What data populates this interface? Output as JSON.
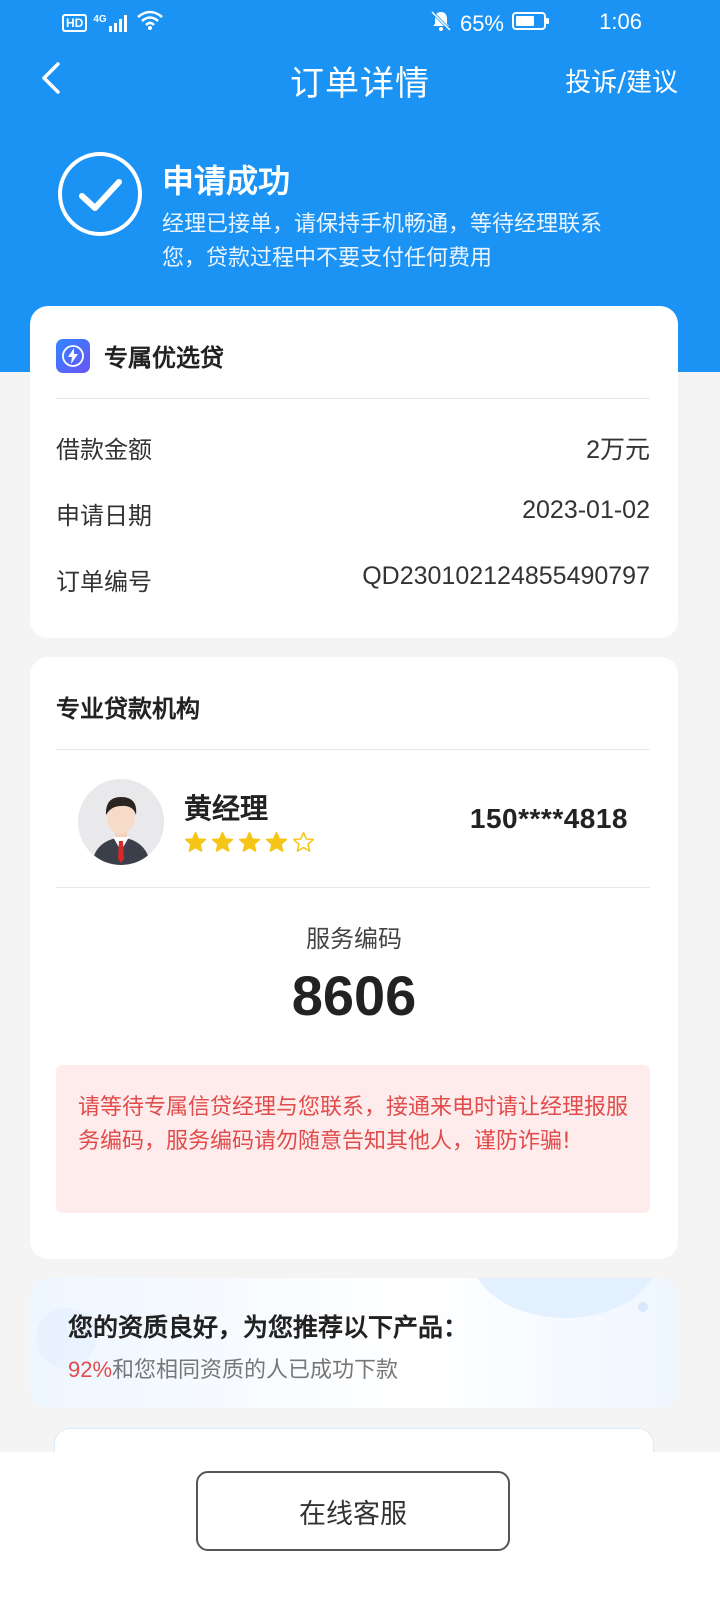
{
  "status_bar": {
    "network": "HD",
    "signal_type": "4G",
    "battery": "65%",
    "time": "1:06"
  },
  "nav": {
    "title": "订单详情",
    "complaint_label": "投诉/建议"
  },
  "success": {
    "title": "申请成功",
    "description": "经理已接单，请保持手机畅通，等待经理联系您，贷款过程中不要支付任何费用"
  },
  "product_card": {
    "title": "专属优选贷",
    "rows": [
      {
        "label": "借款金额",
        "value": "2万元"
      },
      {
        "label": "申请日期",
        "value": "2023-01-02"
      },
      {
        "label": "订单编号",
        "value": "QD230102124855490797"
      }
    ]
  },
  "institution_card": {
    "title": "专业贷款机构",
    "manager": {
      "name": "黄经理",
      "rating": 4,
      "rating_max": 5,
      "phone": "150****4818"
    },
    "service_code_label": "服务编码",
    "service_code": "8606",
    "warning": "请等待专属信贷经理与您联系，接通来电时请让经理报服务编码，服务编码请勿随意告知其他人，谨防诈骗!"
  },
  "recommend": {
    "title": "您的资质良好，为您推荐以下产品：",
    "percent": "92%",
    "subtitle_rest": "和您相同资质的人已成功下款"
  },
  "bottom": {
    "service_button": "在线客服"
  },
  "colors": {
    "brand_blue": "#1a93f5",
    "warning_red": "#e24b4b",
    "warning_bg": "#fdeceb",
    "star_yellow": "#f5c518"
  }
}
